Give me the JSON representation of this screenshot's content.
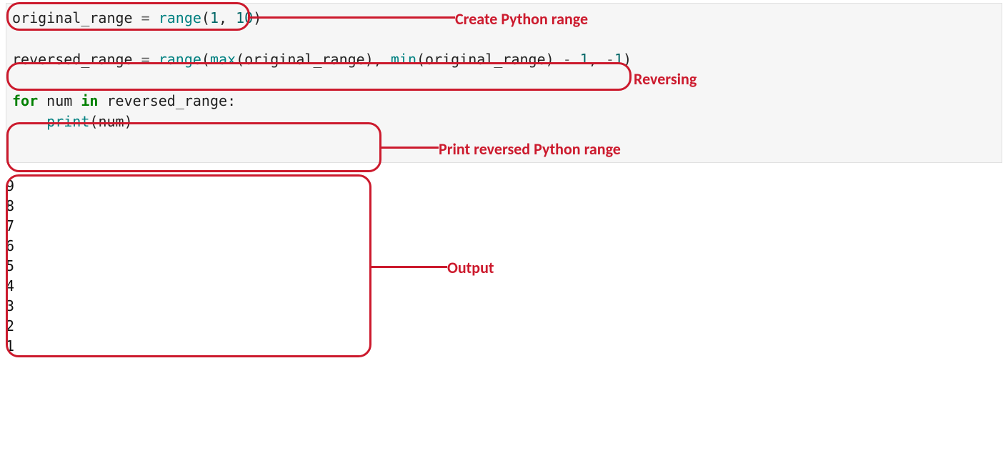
{
  "code": {
    "line1": {
      "lhs": "original_range",
      "eq": " = ",
      "fn": "range",
      "open": "(",
      "arg1": "1",
      "comma": ", ",
      "arg2": "10",
      "close": ")"
    },
    "line2": {
      "lhs": "reversed_range",
      "eq": " = ",
      "fn1": "range",
      "open1": "(",
      "fn2": "max",
      "open2": "(",
      "arg1": "original_range",
      "close2": ")",
      "comma1": ", ",
      "fn3": "min",
      "open3": "(",
      "arg2": "original_range",
      "close3": ")",
      "minus": " - ",
      "one": "1",
      "comma2": ", ",
      "neg": "-",
      "one2": "1",
      "close1": ")"
    },
    "line3": {
      "for": "for",
      "sp1": " ",
      "var": "num",
      "sp2": " ",
      "in": "in",
      "sp3": " ",
      "iter": "reversed_range",
      "colon": ":"
    },
    "line4": {
      "indent": "    ",
      "fn": "print",
      "open": "(",
      "arg": "num",
      "close": ")"
    }
  },
  "annotations": {
    "create": "Create Python range",
    "reverse": "Reversing",
    "print": "Print reversed Python range",
    "output": "Output"
  },
  "output_lines": [
    "9",
    "8",
    "7",
    "6",
    "5",
    "4",
    "3",
    "2",
    "1"
  ]
}
